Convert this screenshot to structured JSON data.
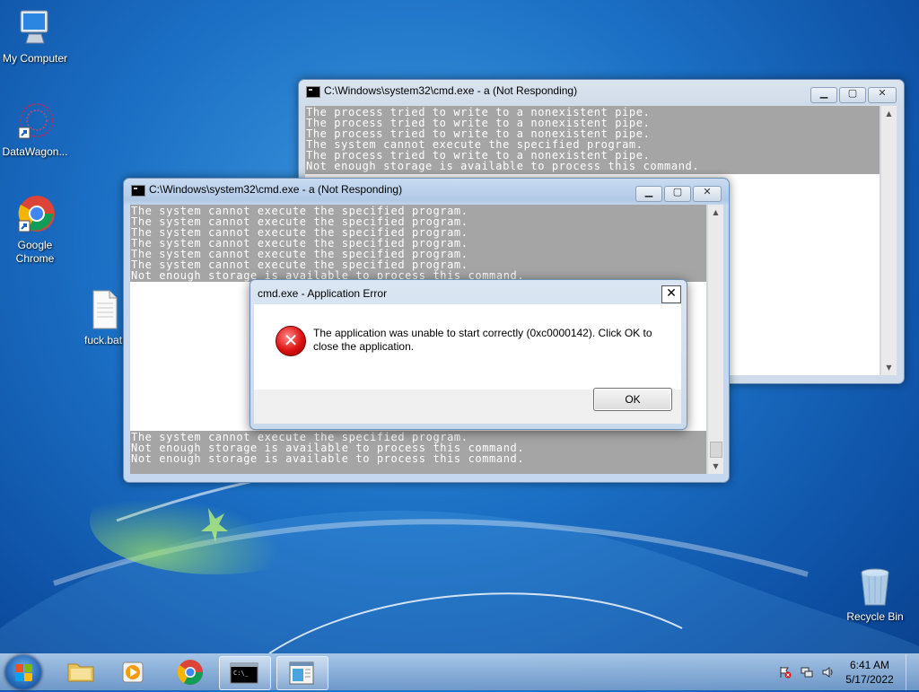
{
  "desktop": {
    "icons": [
      {
        "label": "My Computer",
        "icon": "computer-icon"
      },
      {
        "label": "DataWagon...",
        "icon": "datawagon-icon"
      },
      {
        "label": "Google Chrome",
        "icon": "chrome-icon"
      },
      {
        "label": "fuck.bat",
        "icon": "batch-file-icon"
      },
      {
        "label": "Recycle Bin",
        "icon": "recycle-bin-icon"
      }
    ]
  },
  "window_back": {
    "title": "C:\\Windows\\system32\\cmd.exe - a    (Not Responding)",
    "lines": [
      "The process tried to write to a nonexistent pipe.",
      "The process tried to write to a nonexistent pipe.",
      "The process tried to write to a nonexistent pipe.",
      "The system cannot execute the specified program.",
      "The process tried to write to a nonexistent pipe.",
      "Not enough storage is available to process this command."
    ]
  },
  "window_front": {
    "title": "C:\\Windows\\system32\\cmd.exe - a (Not Responding)",
    "lines_top": [
      "The system cannot execute the specified program.",
      "The system cannot execute the specified program.",
      "The system cannot execute the specified program.",
      "The system cannot execute the specified program.",
      "The system cannot execute the specified program.",
      "The system cannot execute the specified program.",
      "Not enough storage is available to process this command."
    ],
    "lines_bottom": [
      "The system cannot execute the specified program.",
      "Not enough storage is available to process this command.",
      "Not enough storage is available to process this command."
    ]
  },
  "dialog": {
    "title": "cmd.exe - Application Error",
    "message": "The application was unable to start correctly (0xc0000142). Click OK to close the application.",
    "ok_label": "OK",
    "close_glyph": "✕",
    "error_glyph": "✕"
  },
  "window_buttons": {
    "minimize": "▁",
    "maximize": "▢",
    "close": "✕"
  },
  "taskbar": {
    "pinned": [
      "explorer-icon",
      "media-player-icon",
      "chrome-icon",
      "cmd-icon",
      "app-window-icon"
    ],
    "clock_time": "6:41 AM",
    "clock_date": "5/17/2022"
  },
  "colors": {
    "console_bg": "#a5a5a5",
    "console_text": "#ffffff",
    "error_red": "#d11111"
  }
}
